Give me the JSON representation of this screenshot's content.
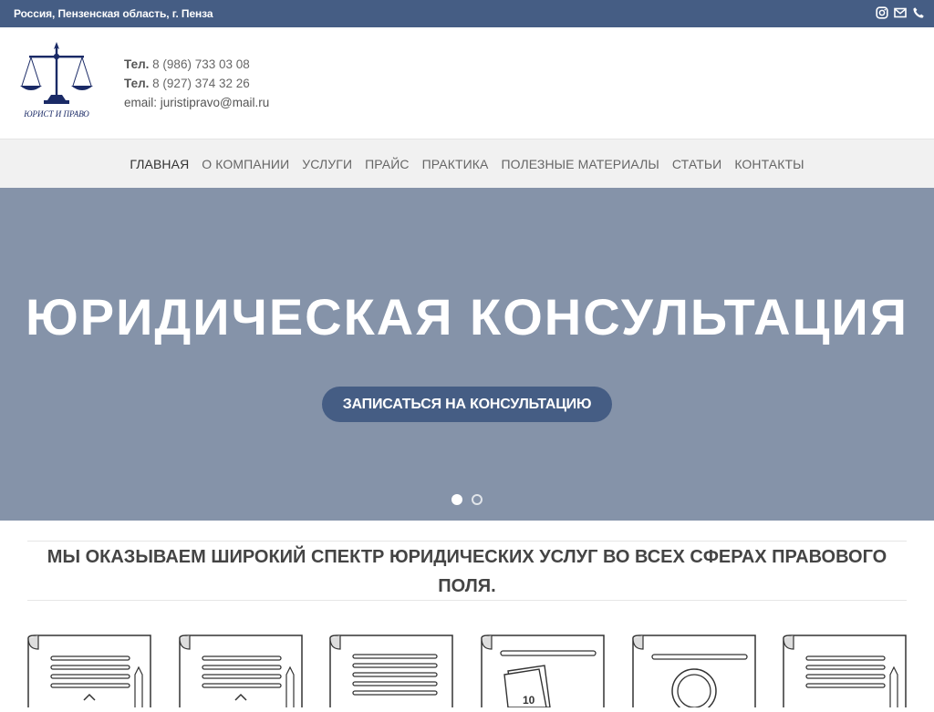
{
  "topbar": {
    "location": "Россия, Пензенская область, г. Пенза",
    "icons": [
      "instagram-icon",
      "mail-icon",
      "phone-icon"
    ]
  },
  "logo": {
    "caption": "ЮРИСТ И ПРАВО"
  },
  "contacts": {
    "phone1_label": "Тел.",
    "phone1": " 8 (986) 733 03 08",
    "phone2_label": "Тел.",
    "phone2": " 8 (927) 374 32 26",
    "email_label": "email:",
    "email": " juristipravo@mail.ru"
  },
  "nav": {
    "items": [
      "ГЛАВНАЯ",
      "О КОМПАНИИ",
      "УСЛУГИ",
      "ПРАЙС",
      "ПРАКТИКА",
      "ПОЛЕЗНЫЕ МАТЕРИАЛЫ",
      "СТАТЬИ",
      "КОНТАКТЫ"
    ],
    "active_index": 0
  },
  "hero": {
    "title": "ЮРИДИЧЕСКАЯ КОНСУЛЬТАЦИЯ",
    "cta_label": "ЗАПИСАТЬСЯ НА КОНСУЛЬТАЦИЮ",
    "slides_count": 2,
    "active_slide": 0
  },
  "tagline": {
    "line1": "МЫ ОКАЗЫВАЕМ ШИРОКИЙ СПЕКТР ЮРИДИЧЕСКИХ УСЛУГ ВО ВСЕХ СФЕРАХ ПРАВОВОГО",
    "line2": "ПОЛЯ."
  },
  "colors": {
    "brand": "#455d84",
    "hero_bg": "#8593a9",
    "nav_bg": "#f1f1f1"
  }
}
